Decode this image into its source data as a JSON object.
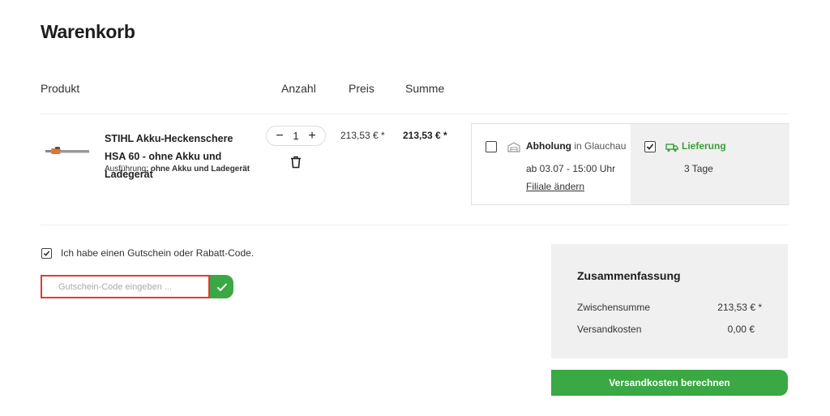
{
  "page": {
    "title": "Warenkorb"
  },
  "table_headers": {
    "product": "Produkt",
    "quantity": "Anzahl",
    "price": "Preis",
    "sum": "Summe"
  },
  "cart_item": {
    "name": "STIHL Akku-Heckenschere HSA 60 - ohne Akku und Ladegerät",
    "variant_label": "Ausführung:",
    "variant_value": "ohne Akku und Ladegerät",
    "quantity": "1",
    "price": "213,53 € *",
    "sum": "213,53 € *"
  },
  "delivery": {
    "pickup": {
      "label": "Abholung",
      "location": "in Glauchau",
      "time": "ab 03.07 - 15:00 Uhr",
      "change_link": "Filiale ändern",
      "checked": false
    },
    "shipping": {
      "label": "Lieferung",
      "duration": "3 Tage",
      "checked": true,
      "color": "#3a9d3a"
    }
  },
  "coupon": {
    "checkbox_label": "Ich habe einen Gutschein oder Rabatt-Code.",
    "checked": true,
    "placeholder": "Gutschein-Code eingeben ..."
  },
  "summary": {
    "title": "Zusammenfassung",
    "rows": [
      {
        "label": "Zwischensumme",
        "value": "213,53 € *"
      },
      {
        "label": "Versandkosten",
        "value": "0,00 €"
      }
    ],
    "button_label": "Versandkosten berechnen"
  },
  "colors": {
    "accent_green": "#3aa843",
    "highlight_red": "#e53935",
    "panel_gray": "#f0f0f0"
  },
  "icons": [
    "product-thumbnail",
    "minus-icon",
    "plus-icon",
    "trash-icon",
    "checkbox-icon",
    "store-icon",
    "truck-icon",
    "checkmark-icon"
  ]
}
